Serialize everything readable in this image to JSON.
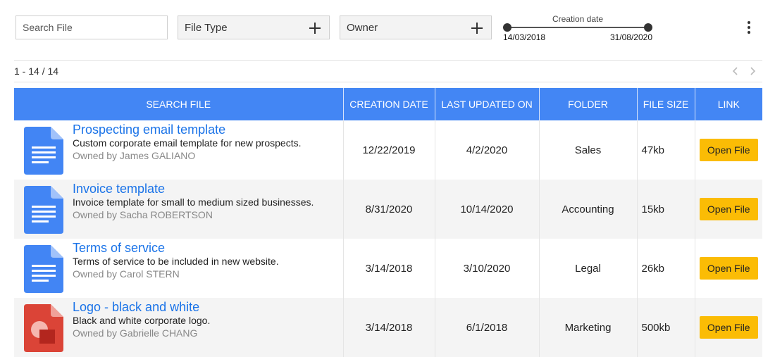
{
  "filters": {
    "search_placeholder": "Search File",
    "file_type_label": "File Type",
    "owner_label": "Owner",
    "date_range": {
      "title": "Creation date",
      "min": "14/03/2018",
      "max": "31/08/2020"
    }
  },
  "pagination": {
    "label": "1 - 14 / 14"
  },
  "table": {
    "columns": [
      "SEARCH FILE",
      "CREATION DATE",
      "LAST UPDATED ON",
      "FOLDER",
      "FILE SIZE",
      "LINK"
    ],
    "rows": [
      {
        "icon": "google-doc-icon",
        "name": "Prospecting email template",
        "description": "Custom corporate email template for new prospects.",
        "owner": "Owned by James GALIANO",
        "created": "12/22/2019",
        "updated": "4/2/2020",
        "folder": "Sales",
        "size": "47kb",
        "link_label": "Open File"
      },
      {
        "icon": "google-doc-icon",
        "name": "Invoice template",
        "description": "Invoice template for small to medium sized businesses.",
        "owner": "Owned by Sacha ROBERTSON",
        "created": "8/31/2020",
        "updated": "10/14/2020",
        "folder": "Accounting",
        "size": "15kb",
        "link_label": "Open File"
      },
      {
        "icon": "google-doc-icon",
        "name": "Terms of service",
        "description": "Terms of service to be included in new website.",
        "owner": "Owned by Carol STERN",
        "created": "3/14/2018",
        "updated": "3/10/2020",
        "folder": "Legal",
        "size": "26kb",
        "link_label": "Open File"
      },
      {
        "icon": "google-drawing-icon",
        "name": "Logo - black and white",
        "description": "Black and white corporate logo.",
        "owner": "Owned by Gabrielle CHANG",
        "created": "3/14/2018",
        "updated": "6/1/2018",
        "folder": "Marketing",
        "size": "500kb",
        "link_label": "Open File"
      }
    ]
  },
  "colors": {
    "header": "#4386f4",
    "link": "#1a73e8",
    "button": "#fbbc05",
    "doc_icon": "#4285f4",
    "drawing_icon": "#db4437"
  }
}
